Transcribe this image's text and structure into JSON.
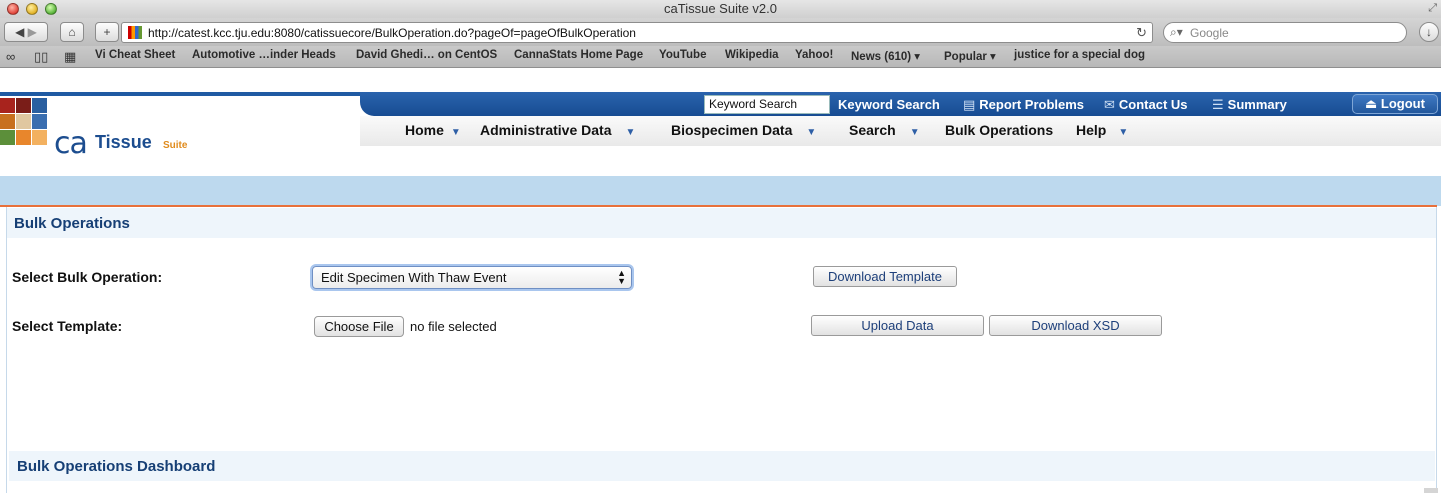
{
  "window": {
    "title": "caTissue Suite v2.0"
  },
  "browser": {
    "url": "http://catest.kcc.tju.edu:8080/catissuecore/BulkOperation.do?pageOf=pageOfBulkOperation",
    "search_placeholder": "Google",
    "bookmarks": [
      "Vi Cheat Sheet",
      "Automotive …inder Heads",
      "David Ghedi… on CentOS",
      "CannaStats Home Page",
      "YouTube",
      "Wikipedia",
      "Yahoo!",
      "News (610) ▾",
      "Popular ▾",
      "justice for a special dog"
    ]
  },
  "header": {
    "keyword_input_value": "Keyword Search",
    "links": {
      "keyword_search": "Keyword Search",
      "report_problems": "Report Problems",
      "contact_us": "Contact Us",
      "summary": "Summary",
      "logout": "Logout"
    },
    "logo": {
      "ca": "ca",
      "tissue": "Tissue",
      "suite": "Suite"
    },
    "menu": {
      "home": "Home",
      "administrative_data": "Administrative Data",
      "biospecimen_data": "Biospecimen Data",
      "search": "Search",
      "bulk_operations": "Bulk Operations",
      "help": "Help"
    }
  },
  "main": {
    "section_title": "Bulk Operations",
    "select_operation_label": "Select Bulk Operation:",
    "select_operation_value": "Edit Specimen With Thaw Event",
    "download_template_label": "Download Template",
    "select_template_label": "Select Template:",
    "choose_file_label": "Choose File",
    "file_status": "no file selected",
    "upload_data_label": "Upload Data",
    "download_xsd_label": "Download XSD",
    "dashboard_title": "Bulk Operations Dashboard"
  },
  "colors": {
    "header_blue": "#1f5aa3",
    "band_blue": "#bdd9ee",
    "accent_orange": "#e8703a",
    "heading_text": "#163f75"
  }
}
